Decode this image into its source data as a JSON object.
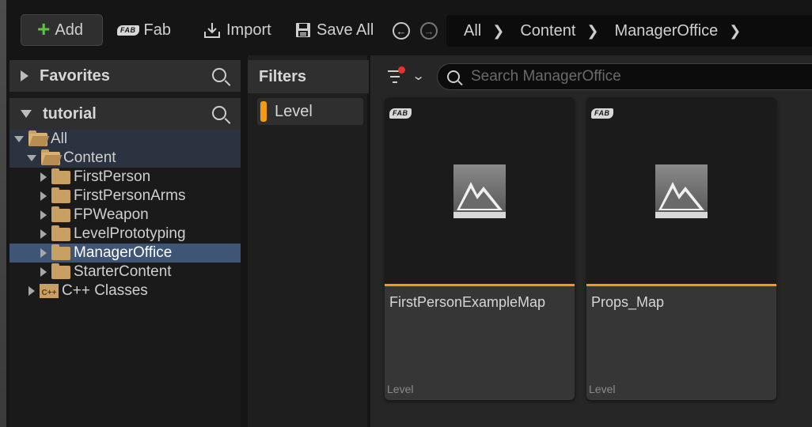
{
  "toolbar": {
    "add_label": "Add",
    "fab_label": "Fab",
    "import_label": "Import",
    "saveall_label": "Save All"
  },
  "breadcrumb": [
    "All",
    "Content",
    "ManagerOffice"
  ],
  "sidebar": {
    "favorites_label": "Favorites",
    "project_label": "tutorial",
    "tree": {
      "all": "All",
      "content": "Content",
      "folders": [
        "FirstPerson",
        "FirstPersonArms",
        "FPWeapon",
        "LevelPrototyping",
        "ManagerOffice",
        "StarterContent"
      ],
      "cpp": "C++ Classes",
      "selected": "ManagerOffice"
    }
  },
  "filters": {
    "title": "Filters",
    "chips": [
      "Level"
    ]
  },
  "search": {
    "placeholder": "Search ManagerOffice"
  },
  "assets": [
    {
      "name": "FirstPersonExampleMap",
      "type": "Level"
    },
    {
      "name": "Props_Map",
      "type": "Level"
    }
  ],
  "fab_badge": "FAB",
  "colors": {
    "accent": "#f39c12",
    "selection": "#3e5575",
    "add_plus": "#5ec24a",
    "notification_dot": "#e5322d"
  }
}
